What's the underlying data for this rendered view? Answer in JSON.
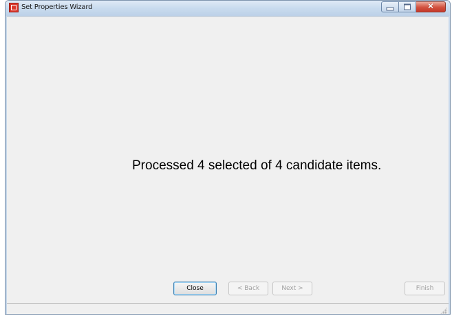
{
  "window": {
    "title": "Set Properties Wizard",
    "icon": "app-icon",
    "caption_buttons": {
      "minimize_glyph": "",
      "maximize_glyph": "",
      "close_glyph": "✕"
    }
  },
  "main": {
    "message": "Processed 4 selected of 4 candidate items."
  },
  "buttons": {
    "close_label": "Close",
    "back_label": "< Back",
    "next_label": "Next >",
    "finish_label": "Finish"
  },
  "colors": {
    "titlebar": "#c9dbee",
    "close_button": "#d2513e",
    "client_background": "#f0f0f0"
  }
}
